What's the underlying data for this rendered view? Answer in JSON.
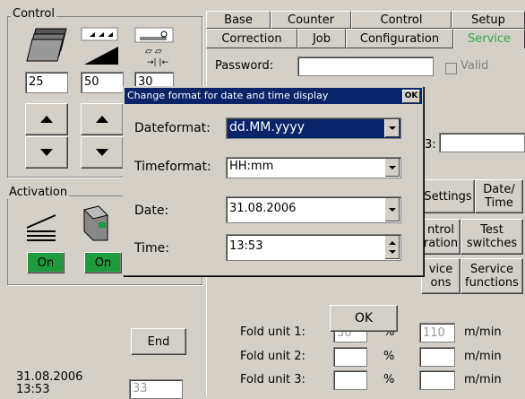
{
  "control": {
    "title": "Control",
    "value1": "25",
    "value2": "50",
    "value3": "30"
  },
  "activation": {
    "title": "Activation",
    "on1": "On",
    "on2": "On"
  },
  "tabs": {
    "row1": [
      "Base",
      "Counter",
      "Control",
      "Setup"
    ],
    "row2": [
      "Correction",
      "Job",
      "Configuration",
      "Service"
    ]
  },
  "password": {
    "label": "Password:",
    "value": "",
    "valid_label": "Valid"
  },
  "field3_label": "3:",
  "side_buttons": {
    "settings": "Settings",
    "date_time": "Date/ Time",
    "control_config": "ntrol ration",
    "test_switches": "Test switches",
    "service_options": "vice ons",
    "service_functions": "Service functions"
  },
  "fold_units": [
    {
      "label": "Fold unit 1:",
      "percent": "50",
      "unit_pct": "%",
      "speed": "110",
      "unit_speed": "m/min"
    },
    {
      "label": "Fold unit 2:",
      "percent": "",
      "unit_pct": "%",
      "speed": "",
      "unit_speed": "m/min"
    },
    {
      "label": "Fold unit 3:",
      "percent": "",
      "unit_pct": "%",
      "speed": "",
      "unit_speed": "m/min"
    }
  ],
  "end_button": "End",
  "status": {
    "date": "31.08.2006",
    "time": "13:53",
    "counter": "33"
  },
  "dialog": {
    "title": "Change format for date and time display",
    "ok_title": "OK",
    "dateformat_label": "Dateformat:",
    "dateformat_value": "dd.MM.yyyy",
    "timeformat_label": "Timeformat:",
    "timeformat_value": "HH:mm",
    "date_label": "Date:",
    "date_value": "31.08.2006",
    "time_label": "Time:",
    "time_value": "13:53",
    "ok_button": "OK"
  },
  "colors": {
    "titlebar": "#0a246a",
    "green_button": "#1e9b3c",
    "active_tab_text": "#2eaa47",
    "background": "#d4d0c8"
  }
}
